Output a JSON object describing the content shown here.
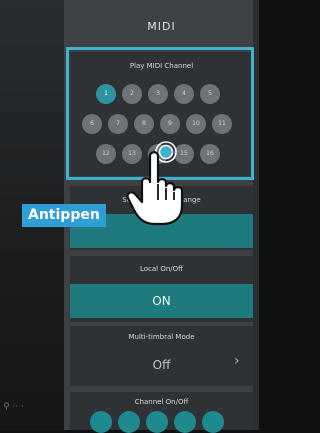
{
  "header": {
    "title": "MIDI"
  },
  "play_channel": {
    "label": "Play MIDI Channel",
    "rows": [
      [
        "1",
        "2",
        "3",
        "4",
        "5"
      ],
      [
        "6",
        "7",
        "8",
        "9",
        "10",
        "11"
      ],
      [
        "12",
        "13",
        "14",
        "15",
        "16"
      ]
    ],
    "selected": "1"
  },
  "program_change": {
    "label": "Send Program Change"
  },
  "local": {
    "label": "Local On/Off",
    "value": "ON"
  },
  "multi_timbral": {
    "label": "Multi-timbral Mode",
    "value": "Off"
  },
  "channel_onoff": {
    "label": "Channel On/Off"
  },
  "callout": {
    "text": "Antippen"
  },
  "colors": {
    "accent": "#1f7a7d",
    "highlight": "#3fb2cf",
    "badge": "#2f9ed7"
  },
  "icons": {
    "pointer": "hand-pointer-icon",
    "ripple": "tap-ripple-icon",
    "chevron": "chevron-right-icon"
  }
}
